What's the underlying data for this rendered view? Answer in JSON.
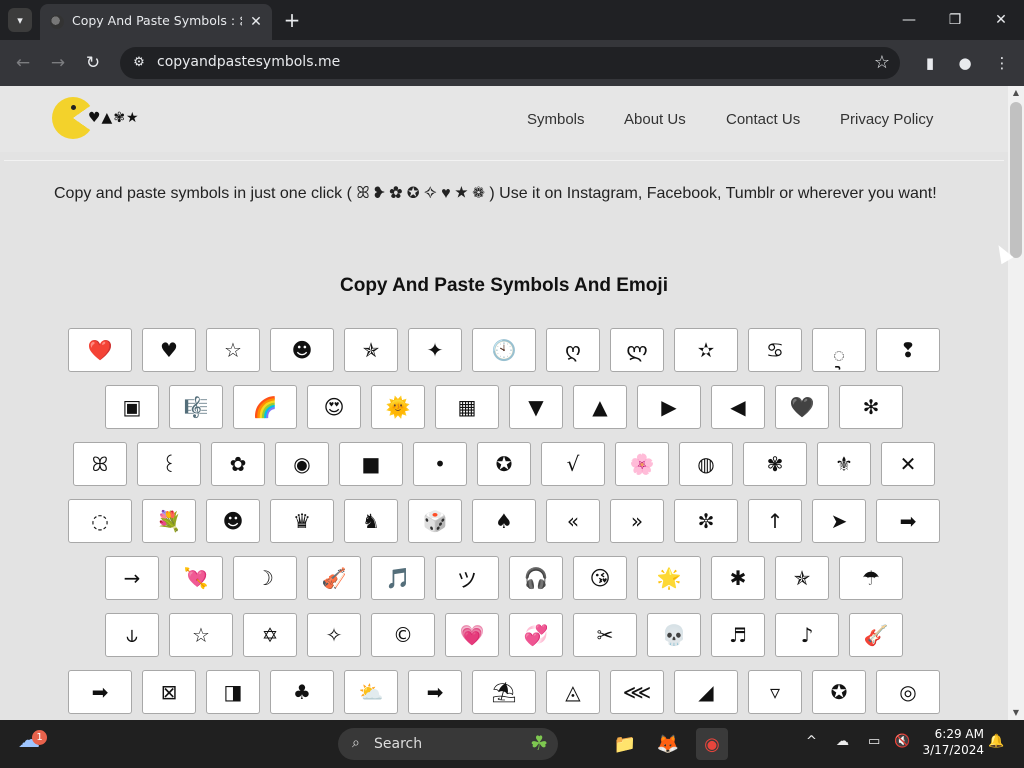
{
  "browser": {
    "tab_title": "Copy And Paste Symbols :",
    "tab_title_symbols": "⊱⭑☾",
    "tab_list_icon": "▾",
    "tab_close_icon": "✕",
    "new_tab_icon": "+",
    "minimize_icon": "—",
    "restore_icon": "❐",
    "close_icon": "✕",
    "back_icon": "←",
    "forward_icon": "→",
    "reload_icon": "↻",
    "site_info_icon": "⚙",
    "url": "copyandpastesymbols.me",
    "bookmark_icon": "☆",
    "side_panel_icon": "▮",
    "profile_icon": "●",
    "menu_icon": "⋮"
  },
  "site": {
    "logo_symbols": "♥▲✾★",
    "nav": [
      {
        "label": "Symbols"
      },
      {
        "label": "About Us"
      },
      {
        "label": "Contact Us"
      },
      {
        "label": "Privacy Policy"
      }
    ],
    "intro": "Copy and paste symbols in just one click ( ꕤ ❥ ✿ ✪ ✧ ♥ ★ ❁ ) Use it on Instagram, Facebook, Tumblr or wherever you want!",
    "heading": "Copy And Paste Symbols And Emoji"
  },
  "symbol_rows": [
    [
      "❤️",
      "♥",
      "☆",
      "☻",
      "✯",
      "✦",
      "🕙",
      "ღ",
      "ლ",
      "✫",
      "♋",
      "ᢩ",
      "❢"
    ],
    [
      "▣",
      "🎼",
      "🌈",
      "😍",
      "🌞",
      "▦",
      "▼",
      "▲",
      "▶",
      "◀",
      "🖤",
      "✻"
    ],
    [
      "ꕤ",
      "꒰",
      "✿",
      "◉",
      "■",
      "•",
      "✪",
      "√",
      "🌸",
      "◍",
      "✾",
      "⚜",
      "✕"
    ],
    [
      "◌",
      "💐",
      "☻",
      "♛",
      "♞",
      "🎲",
      "♠",
      "«",
      "»",
      "✼",
      "↑",
      "➤",
      "➡"
    ],
    [
      "→",
      "💘",
      "☽",
      "🎻",
      "🎵",
      "ツ",
      "🎧",
      "😘",
      "🌟",
      "✱",
      "✯",
      "☂"
    ],
    [
      "⫝",
      "☆",
      "✡",
      "✧",
      "©",
      "💗",
      "💞",
      "✂",
      "💀",
      "♬",
      "♪",
      "🎸"
    ],
    [
      "➡",
      "⊠",
      "◨",
      "♣",
      "⛅",
      "➡",
      "⛱",
      "◬",
      "⋘",
      "◢",
      "▿",
      "✪",
      "◎"
    ]
  ],
  "taskbar": {
    "weather_icon": "☁",
    "notification_count": "1",
    "search_icon": "⌕",
    "search_label": "Search",
    "search_decoration": "☘",
    "apps": [
      "📁",
      "🦊",
      "◉"
    ],
    "tray_chevron": "^",
    "tray_cloud": "☁",
    "tray_network": "▭",
    "tray_volume": "🔇",
    "time": "6:29 AM",
    "date": "3/17/2024",
    "bell_icon": "🔔"
  }
}
